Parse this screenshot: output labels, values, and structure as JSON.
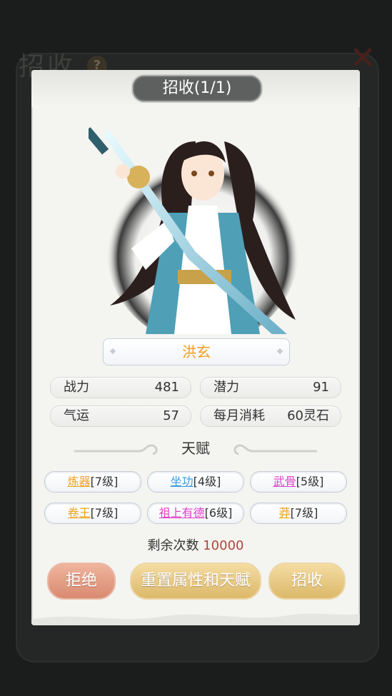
{
  "background": {
    "top_stats": [
      "",
      "",
      "",
      "",
      "",
      ""
    ],
    "title": "招收",
    "help_icon": "question-icon",
    "close_icon": "close-icon"
  },
  "dialog": {
    "title": "招收(1/1)",
    "character_name": "洪玄",
    "stats": [
      {
        "label": "战力",
        "value": "481"
      },
      {
        "label": "潜力",
        "value": "91"
      },
      {
        "label": "气运",
        "value": "57"
      },
      {
        "label": "每月消耗",
        "value": "60灵石"
      }
    ],
    "talent_heading": "天赋",
    "talents": [
      {
        "name": "炼器",
        "level": "[7级]",
        "color": "#f0a21e"
      },
      {
        "name": "坐功",
        "level": "[4级]",
        "color": "#3a9ee0"
      },
      {
        "name": "武骨",
        "level": "[5级]",
        "color": "#e03fc9"
      },
      {
        "name": "卷王",
        "level": "[7级]",
        "color": "#f0a21e"
      },
      {
        "name": "祖上有德",
        "level": "[6级]",
        "color": "#e03fc9"
      },
      {
        "name": "莽",
        "level": "[7级]",
        "color": "#f0a21e"
      }
    ],
    "remaining_label": "剩余次数",
    "remaining_count": "10000",
    "buttons": {
      "reject": "拒绝",
      "reset": "重置属性和天赋",
      "recruit": "招收"
    }
  },
  "colors": {
    "name": "#f19d1c",
    "remaining_count": "#b0453c",
    "reject_button": "#d98a70",
    "gold_button": "#dcb86a"
  }
}
